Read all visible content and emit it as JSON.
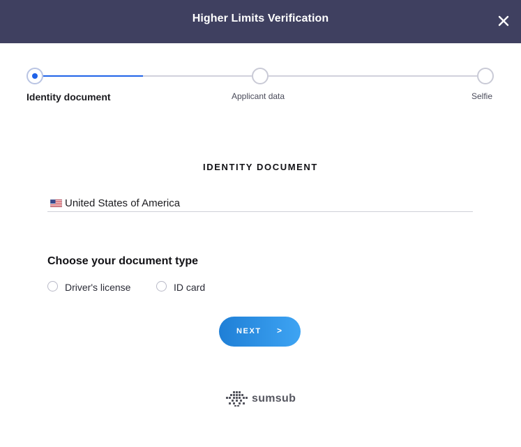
{
  "header": {
    "title": "Higher Limits Verification",
    "close_icon": "close-icon"
  },
  "stepper": {
    "steps": [
      {
        "label": "Identity document",
        "state": "active"
      },
      {
        "label": "Applicant data",
        "state": "pending"
      },
      {
        "label": "Selfie",
        "state": "pending"
      }
    ],
    "accent_color": "#1f62e8"
  },
  "form": {
    "section_title": "IDENTITY DOCUMENT",
    "country": {
      "value": "United States of America",
      "flag_icon": "us-flag-icon"
    },
    "document_type": {
      "title": "Choose your document type",
      "options": [
        {
          "label": "Driver's license",
          "selected": false
        },
        {
          "label": "ID card",
          "selected": false
        }
      ]
    },
    "next_button": {
      "label": "NEXT",
      "arrow": ">"
    }
  },
  "footer": {
    "brand_name": "sumsub",
    "brand_icon": "sumsub-logo-icon"
  },
  "colors": {
    "header_bg": "#3f4060",
    "button_gradient_start": "#1f7fd6",
    "button_gradient_end": "#3ea4f3"
  }
}
